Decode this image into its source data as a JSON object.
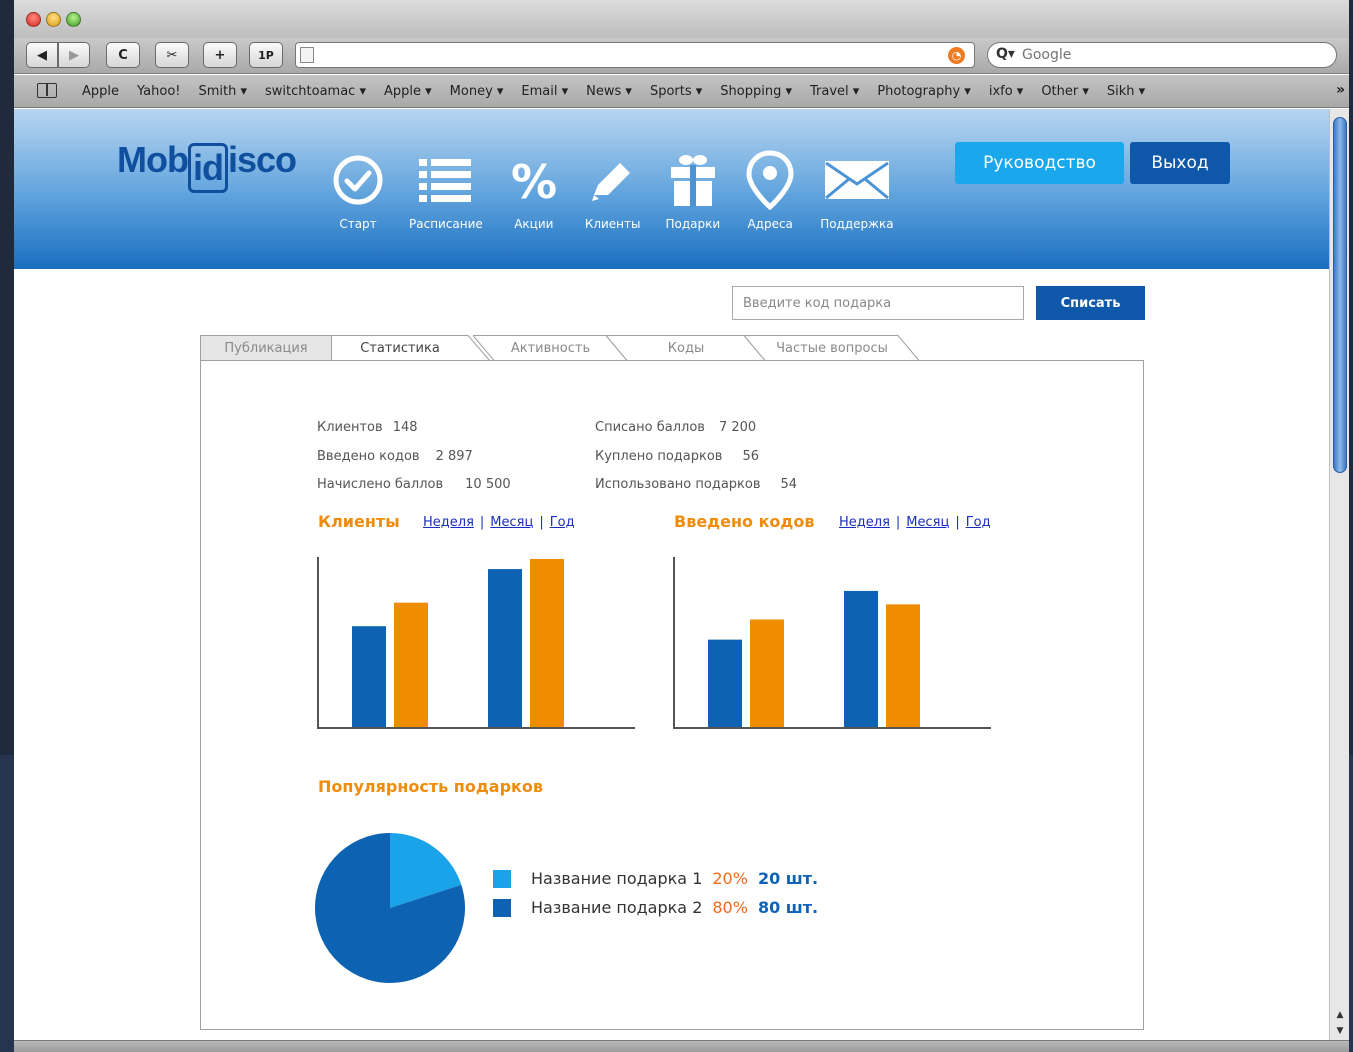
{
  "browser": {
    "search_placeholder": "Google",
    "toolbar_buttons": [
      "◀",
      "▶",
      "C",
      "✂",
      "+",
      "1P"
    ],
    "bookmarks": [
      "Apple",
      "Yahoo!",
      "Smith ▾",
      "switchtoamac ▾",
      "Apple ▾",
      "Money ▾",
      "Email ▾",
      "News ▾",
      "Sports ▾",
      "Shopping ▾",
      "Travel ▾",
      "Photography ▾",
      "ixfo ▾",
      "Other ▾",
      "Sikh ▾"
    ],
    "bookmarks_more": "»"
  },
  "header": {
    "logo": {
      "before": "Mob",
      "framed": "id",
      "after": "isco"
    },
    "nav": [
      {
        "label": "Старт",
        "icon": "check-circle-icon"
      },
      {
        "label": "Расписание",
        "icon": "list-icon"
      },
      {
        "label": "Акции",
        "icon": "percent-icon"
      },
      {
        "label": "Клиенты",
        "icon": "pencil-icon"
      },
      {
        "label": "Подарки",
        "icon": "gift-icon"
      },
      {
        "label": "Адреса",
        "icon": "map-pin-icon"
      },
      {
        "label": "Поддержка",
        "icon": "envelope-icon"
      }
    ],
    "guide_button": "Руководство",
    "exit_button": "Выход"
  },
  "gift_code": {
    "placeholder": "Введите код подарка",
    "button": "Списать"
  },
  "tabs": [
    "Публикация",
    "Статистика",
    "Активность",
    "Коды",
    "Частые вопросы"
  ],
  "active_tab": 1,
  "stats": {
    "left": [
      {
        "label": "Клиентов",
        "value": "148"
      },
      {
        "label": "Введено кодов",
        "value": "2 897"
      },
      {
        "label": "Начислено баллов",
        "value": "10 500"
      }
    ],
    "right": [
      {
        "label": "Списано баллов",
        "value": "7 200"
      },
      {
        "label": "Куплено подарков",
        "value": "56"
      },
      {
        "label": "Использовано подарков",
        "value": "54"
      }
    ]
  },
  "period_links": [
    "Неделя",
    "Месяц",
    "Год"
  ],
  "colors": {
    "series_blue": "#0d63b1",
    "series_orange": "#f08c00",
    "pie_light": "#1aa3e8",
    "pie_dark": "#0d63b1"
  },
  "chart_data": [
    {
      "type": "bar",
      "title": "Клиенты",
      "categories": [
        "",
        ""
      ],
      "series": [
        {
          "values": [
            60,
            94
          ]
        },
        {
          "values": [
            74,
            100
          ]
        }
      ],
      "ylim": [
        0,
        100
      ],
      "grid": false
    },
    {
      "type": "bar",
      "title": "Введено кодов",
      "categories": [
        "",
        ""
      ],
      "series": [
        {
          "values": [
            52,
            81
          ]
        },
        {
          "values": [
            64,
            73
          ]
        }
      ],
      "ylim": [
        0,
        100
      ],
      "grid": false
    },
    {
      "type": "pie",
      "title": "Популярность подарков",
      "slices": [
        {
          "name": "Название подарка 1",
          "value": 20,
          "percent": "20%",
          "count": "20 шт."
        },
        {
          "name": "Название подарка 2",
          "value": 80,
          "percent": "80%",
          "count": "80 шт."
        }
      ]
    }
  ]
}
